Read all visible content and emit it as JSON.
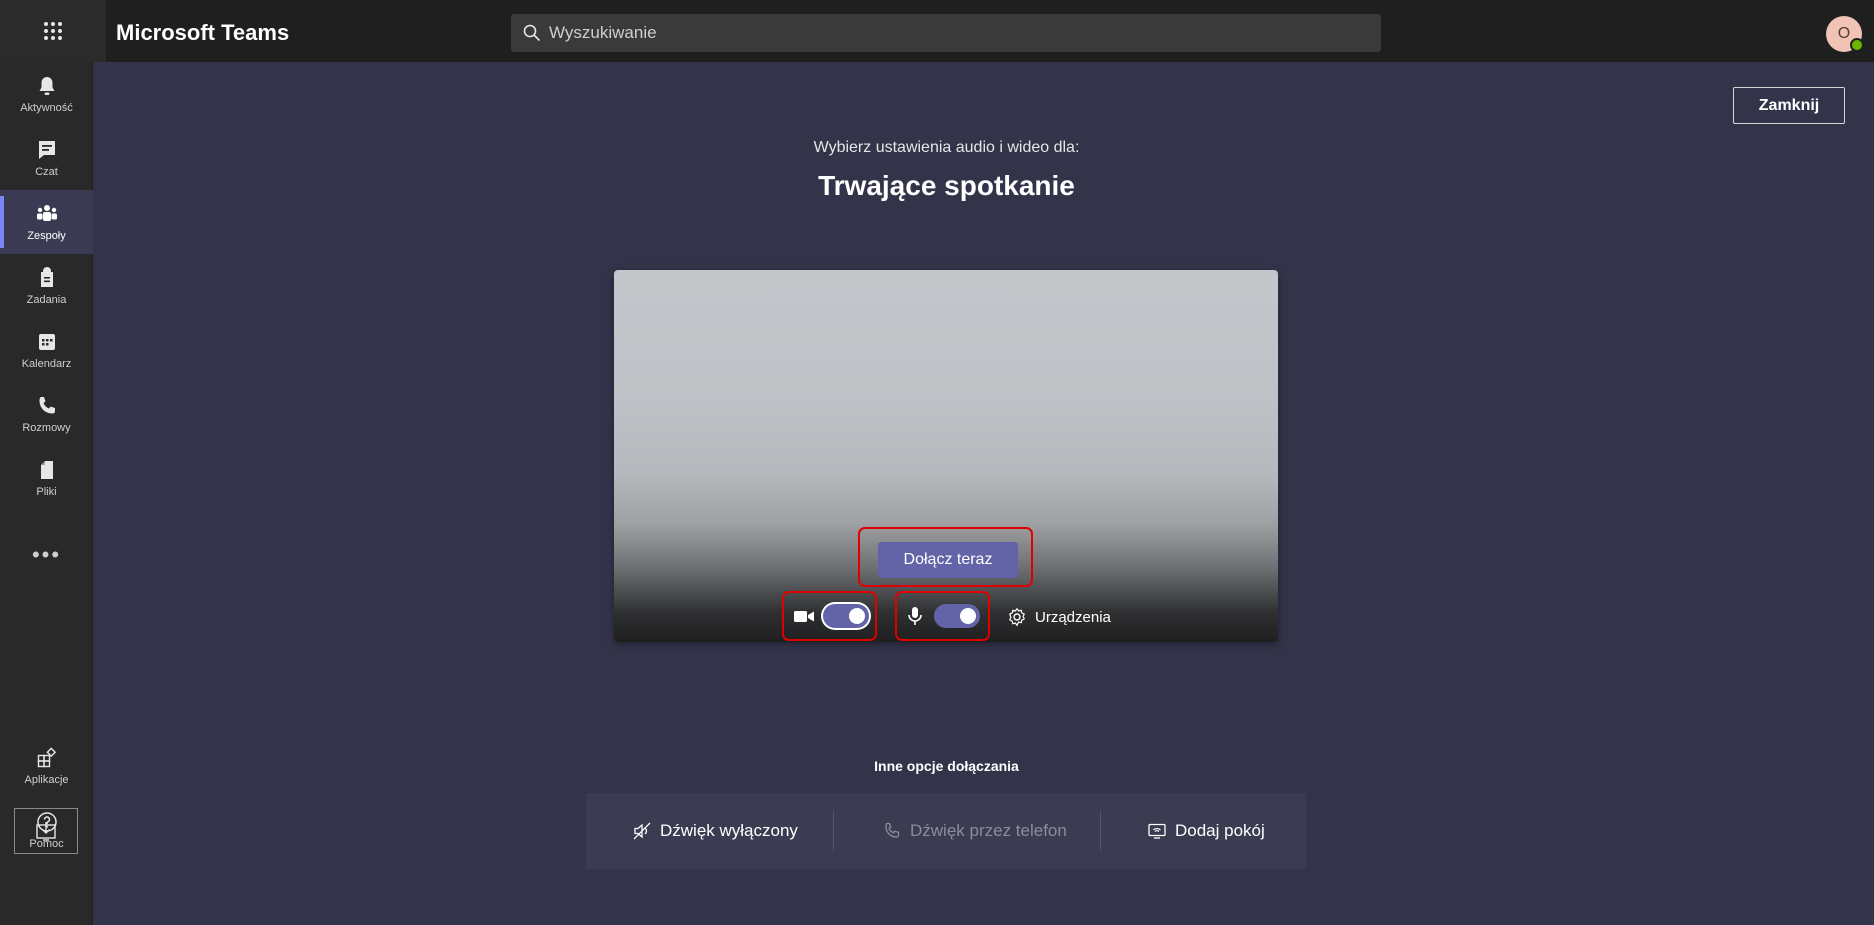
{
  "app": {
    "title": "Microsoft Teams"
  },
  "search": {
    "placeholder": "Wyszukiwanie"
  },
  "user": {
    "avatar_initial": "O",
    "presence_color": "#6bb700"
  },
  "rail": {
    "items": [
      {
        "label": "Aktywność",
        "icon": "bell-icon"
      },
      {
        "label": "Czat",
        "icon": "chat-icon"
      },
      {
        "label": "Zespoły",
        "icon": "teams-icon",
        "active": true
      },
      {
        "label": "Zadania",
        "icon": "tasks-icon"
      },
      {
        "label": "Kalendarz",
        "icon": "calendar-icon"
      },
      {
        "label": "Rozmowy",
        "icon": "phone-icon"
      },
      {
        "label": "Pliki",
        "icon": "file-icon"
      }
    ],
    "more_label": "•••",
    "bottom": [
      {
        "label": "Aplikacje",
        "icon": "apps-icon"
      },
      {
        "label": "Pomoc",
        "icon": "help-icon"
      }
    ]
  },
  "prejoin": {
    "close_label": "Zamknij",
    "subtitle": "Wybierz ustawienia audio i wideo dla:",
    "title": "Trwające spotkanie",
    "join_label": "Dołącz teraz",
    "camera_on": true,
    "mic_on": true,
    "devices_label": "Urządzenia"
  },
  "other_options": {
    "title": "Inne opcje dołączania",
    "audio_off_label": "Dźwięk wyłączony",
    "phone_audio_label": "Dźwięk przez telefon",
    "add_room_label": "Dodaj pokój"
  },
  "colors": {
    "accent": "#6264a7",
    "stage": "#33344a",
    "highlight": "#e00000"
  }
}
